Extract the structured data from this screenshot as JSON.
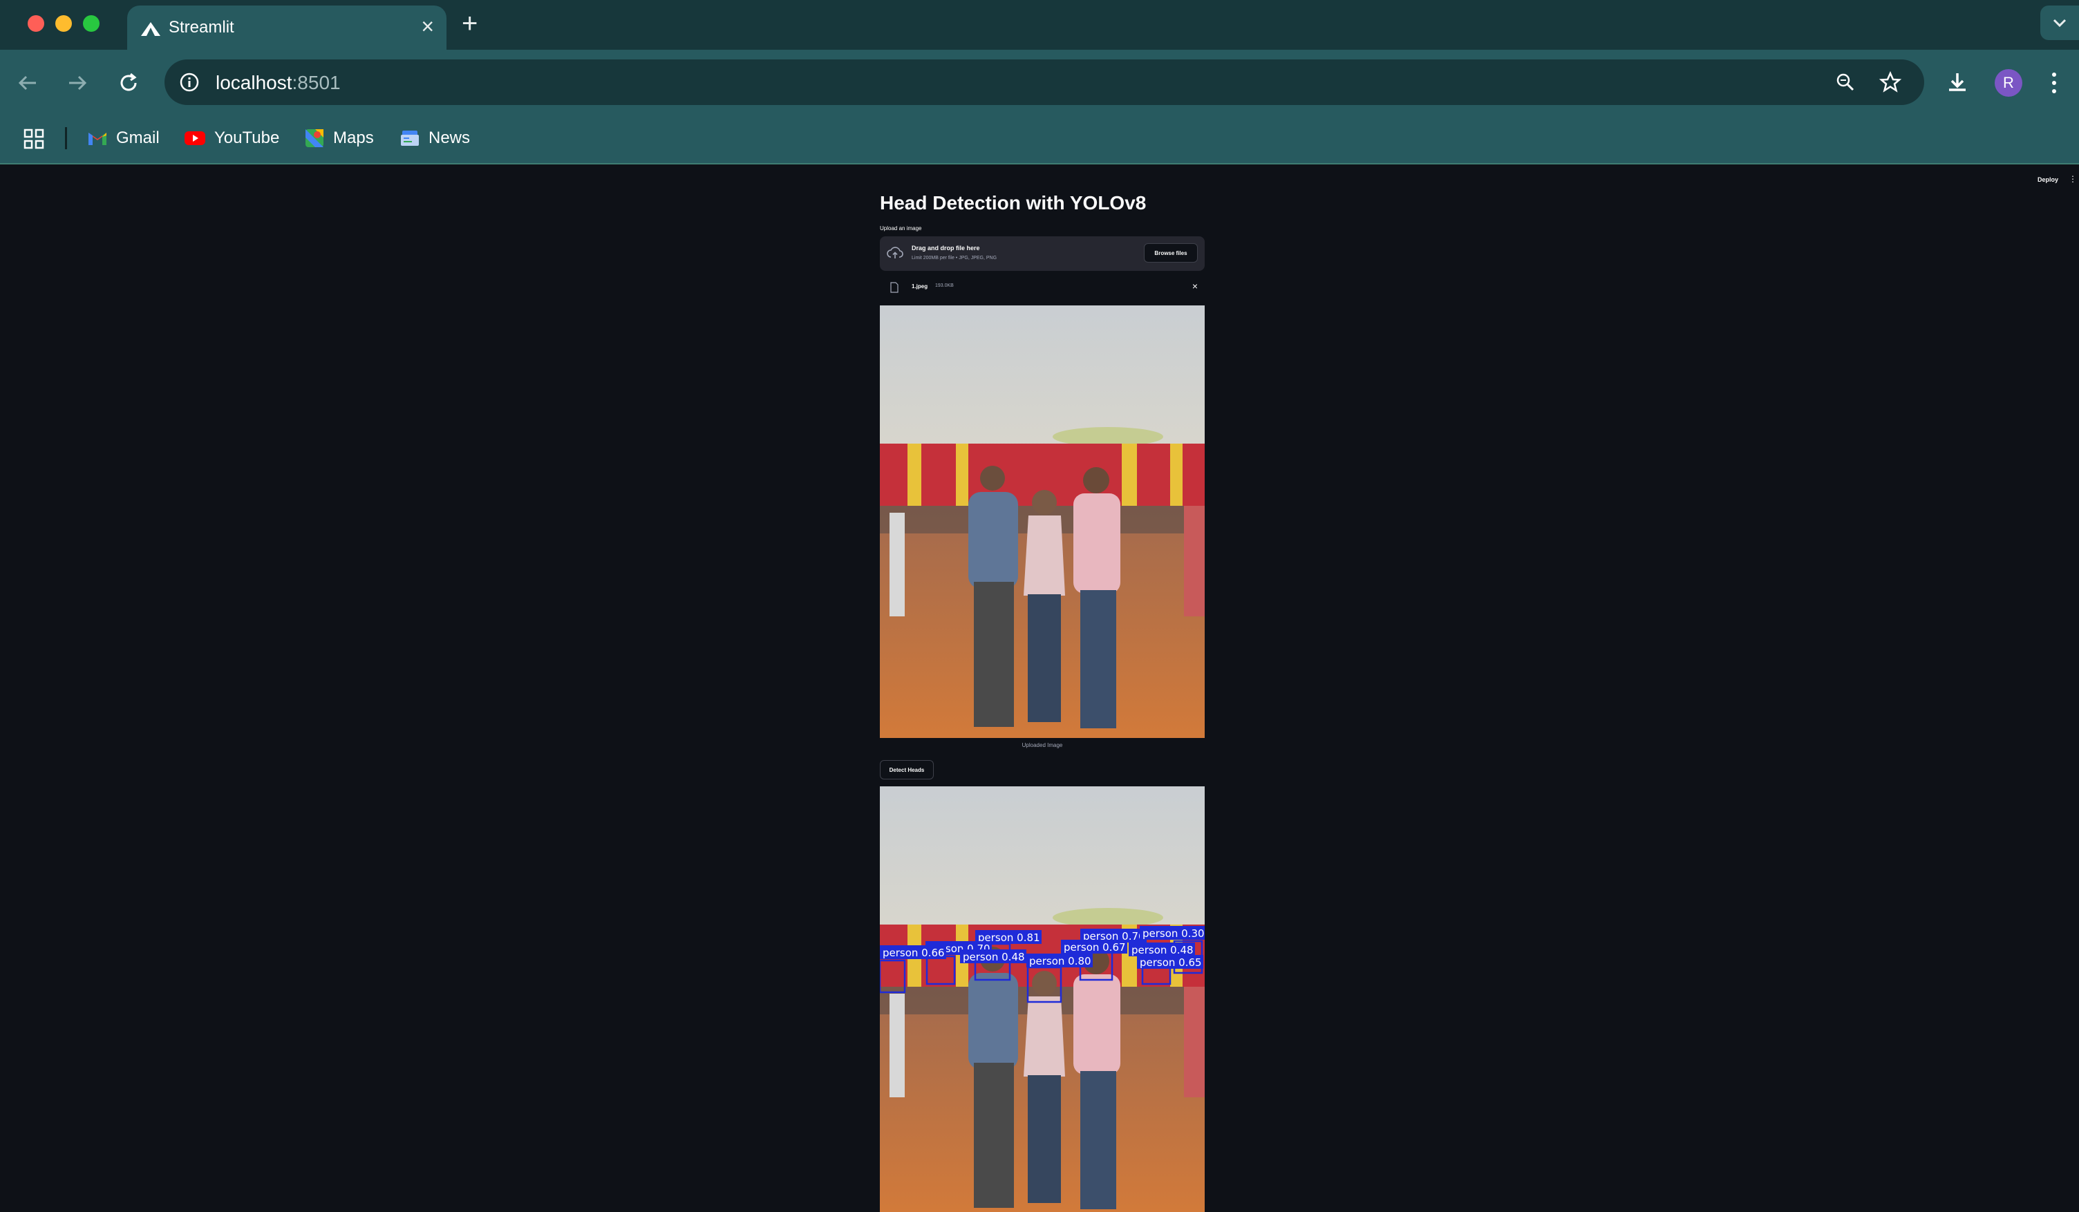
{
  "browser": {
    "tab_title": "Streamlit",
    "url_host": "localhost",
    "url_port": ":8501",
    "profile_initial": "R",
    "bookmarks": [
      "Gmail",
      "YouTube",
      "Maps",
      "News"
    ]
  },
  "app": {
    "deploy_label": "Deploy",
    "menu_icon": "⋮",
    "title": "Head Detection with YOLOv8",
    "uploader": {
      "label": "Upload an image",
      "drop_title": "Drag and drop file here",
      "limit_text": "Limit 200MB per file • JPG, JPEG, PNG",
      "browse_label": "Browse files"
    },
    "uploaded_file": {
      "name": "1.jpeg",
      "size": "193.0KB"
    },
    "image_caption": "Uploaded Image",
    "detect_label": "Detect Heads",
    "detections": [
      "person 0.81",
      "person 0.76",
      "person 0.30",
      "person 0.70",
      "person 0.48",
      "person 0.67",
      "person 0.48",
      "person 0.66",
      "person 0.80",
      "person 0.65"
    ]
  },
  "colors": {
    "tabstrip": "#17373b",
    "toolbar": "#275a5f",
    "page_background": "#0e1117",
    "dropzone": "#262730",
    "detection_box": "#1f2bd8"
  }
}
